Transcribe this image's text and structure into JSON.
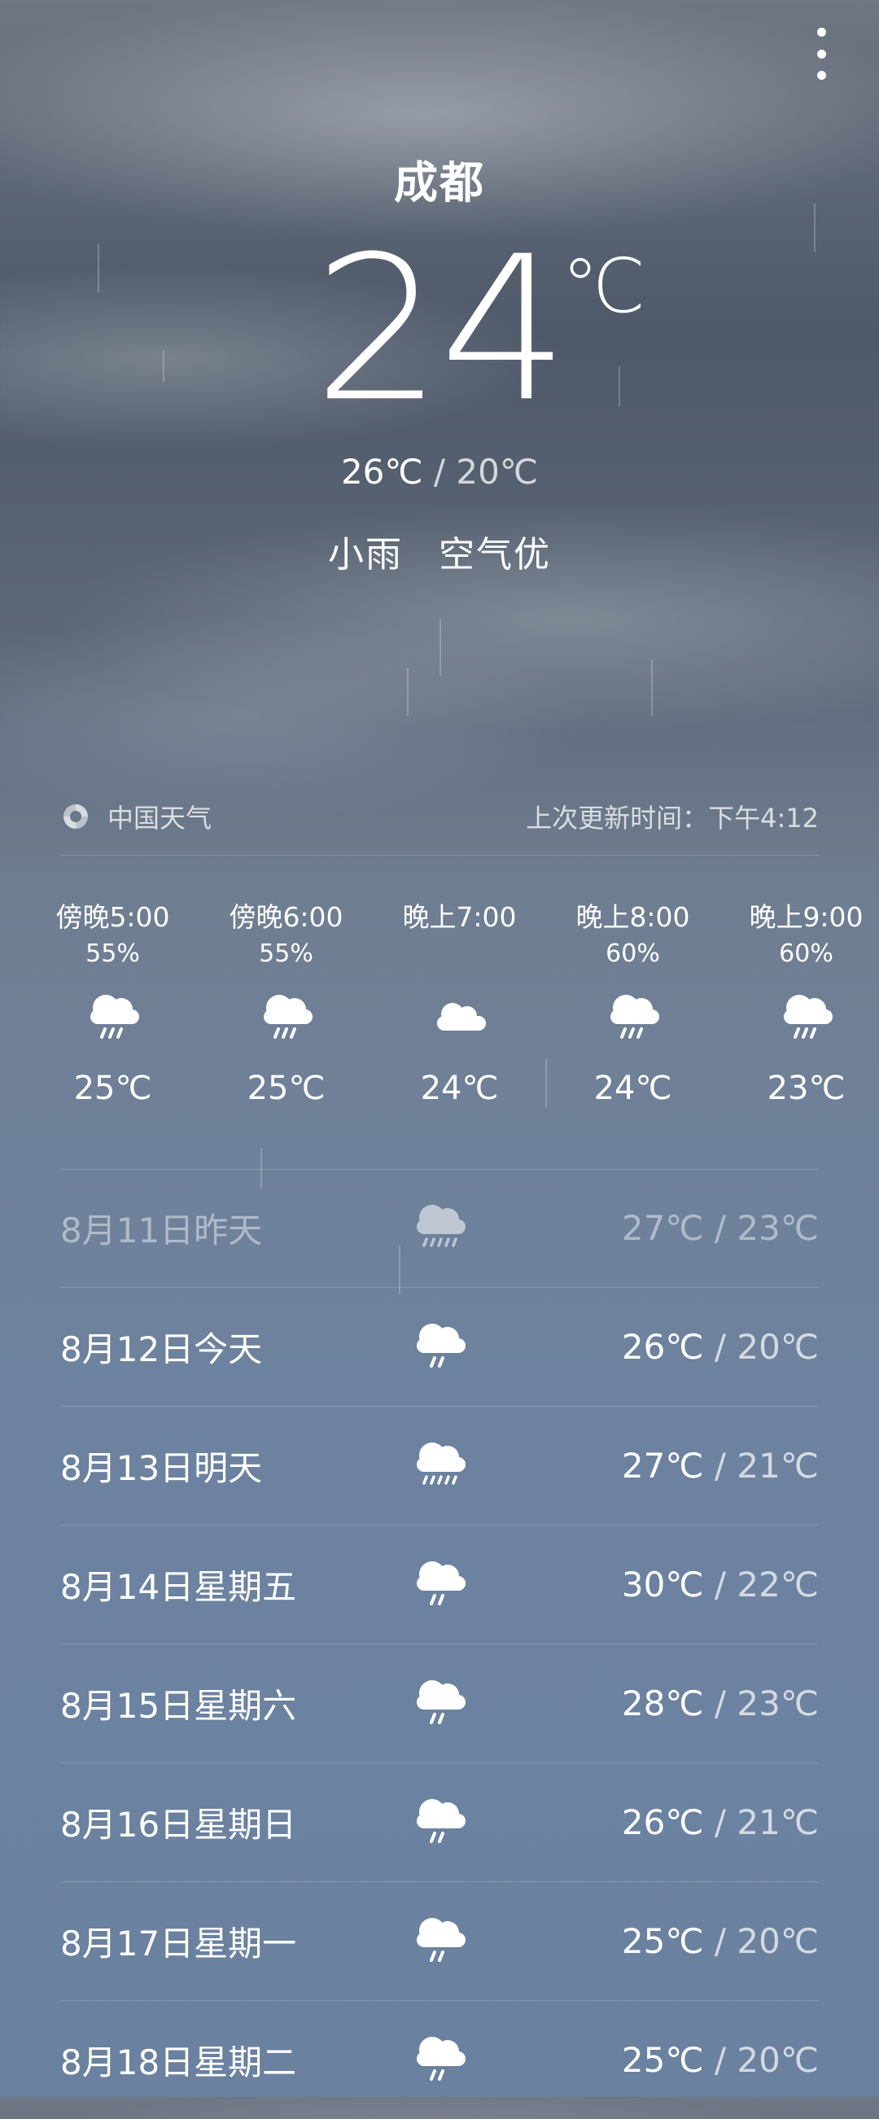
{
  "header": {
    "city": "成都",
    "temperature": "24",
    "unit": "℃",
    "high": "26℃",
    "range_sep": " / ",
    "low": "20℃",
    "condition": "小雨",
    "air_quality": "空气优",
    "menu_icon": "more-vertical-icon"
  },
  "source": {
    "provider": "中国天气",
    "provider_icon": "swirl-logo-icon",
    "updated_label": "上次更新时间：下午4:12"
  },
  "hourly": [
    {
      "time": "傍晚5:00",
      "precip": "55%",
      "icon": "cloud-rain-icon",
      "temp": "25℃"
    },
    {
      "time": "傍晚6:00",
      "precip": "55%",
      "icon": "cloud-rain-icon",
      "temp": "25℃"
    },
    {
      "time": "晚上7:00",
      "precip": "",
      "icon": "cloud-icon",
      "temp": "24℃"
    },
    {
      "time": "晚上8:00",
      "precip": "60%",
      "icon": "cloud-rain-icon",
      "temp": "24℃"
    },
    {
      "time": "晚上9:00",
      "precip": "60%",
      "icon": "cloud-rain-icon",
      "temp": "23℃"
    }
  ],
  "daily": [
    {
      "date": "8月11日昨天",
      "icon": "cloud-heavy-rain-icon",
      "high": "27℃",
      "low": "23℃"
    },
    {
      "date": "8月12日今天",
      "icon": "cloud-rain-icon",
      "high": "26℃",
      "low": "20℃"
    },
    {
      "date": "8月13日明天",
      "icon": "cloud-heavy-rain-icon",
      "high": "27℃",
      "low": "21℃"
    },
    {
      "date": "8月14日星期五",
      "icon": "cloud-rain-icon",
      "high": "30℃",
      "low": "22℃"
    },
    {
      "date": "8月15日星期六",
      "icon": "cloud-rain-icon",
      "high": "28℃",
      "low": "23℃"
    },
    {
      "date": "8月16日星期日",
      "icon": "cloud-rain-icon",
      "high": "26℃",
      "low": "21℃"
    },
    {
      "date": "8月17日星期一",
      "icon": "cloud-rain-icon",
      "high": "25℃",
      "low": "20℃"
    },
    {
      "date": "8月18日星期二",
      "icon": "cloud-rain-icon",
      "high": "25℃",
      "low": "20℃"
    }
  ],
  "colors": {
    "sky_top": "#4e5868",
    "sky_bottom": "#6a819f",
    "text": "#ffffff"
  }
}
